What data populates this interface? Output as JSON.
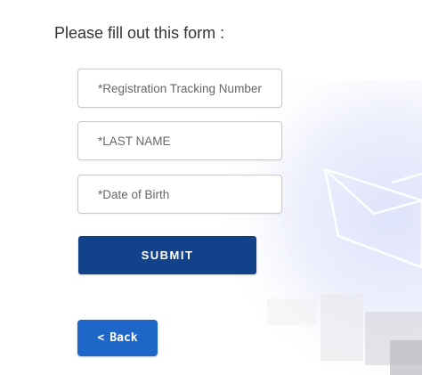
{
  "form": {
    "heading": "Please fill out this form :",
    "fields": {
      "registration": {
        "placeholder": "*Registration Tracking Number",
        "value": ""
      },
      "last_name": {
        "placeholder": "*LAST NAME",
        "value": ""
      },
      "dob": {
        "placeholder": "*Date of Birth",
        "value": ""
      }
    },
    "submit_label": "SUBMIT",
    "back": {
      "icon": "<",
      "label": "Back"
    }
  },
  "colors": {
    "submit_bg": "#12428a",
    "back_bg": "#1f66c9",
    "text": "#333333"
  }
}
